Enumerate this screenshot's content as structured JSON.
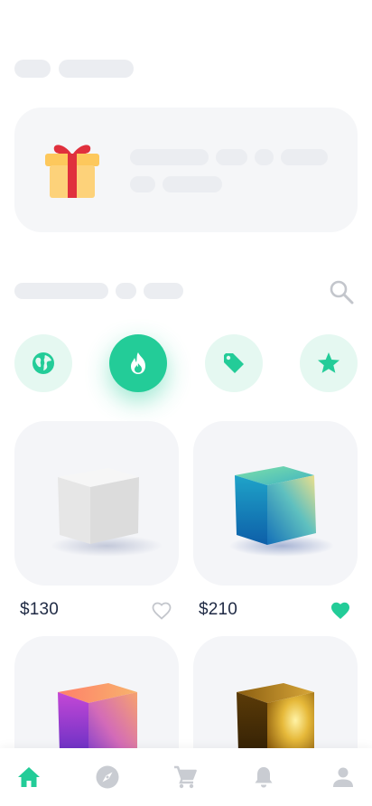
{
  "icons": {
    "gift": "gift-icon",
    "search": "search-icon",
    "categories": [
      "globe-icon",
      "fire-icon",
      "tag-icon",
      "star-icon"
    ],
    "tabs": [
      "home-icon",
      "compass-icon",
      "cart-icon",
      "bell-icon",
      "profile-icon"
    ]
  },
  "colors": {
    "accent": "#23cc98",
    "accent_soft": "#e5f8f1",
    "skeleton": "#ebedf1",
    "price_text": "#1f2a44",
    "gift_box": "#fdd27a",
    "gift_ribbon": "#e0303d"
  },
  "categories": {
    "active": "fire-icon"
  },
  "products": [
    {
      "price": "$130",
      "favorite": false,
      "cube": "white"
    },
    {
      "price": "$210",
      "favorite": true,
      "cube": "teal-gradient"
    },
    {
      "cube": "purple-gradient"
    },
    {
      "cube": "gold"
    }
  ],
  "tabbar": {
    "active": "home-icon"
  }
}
